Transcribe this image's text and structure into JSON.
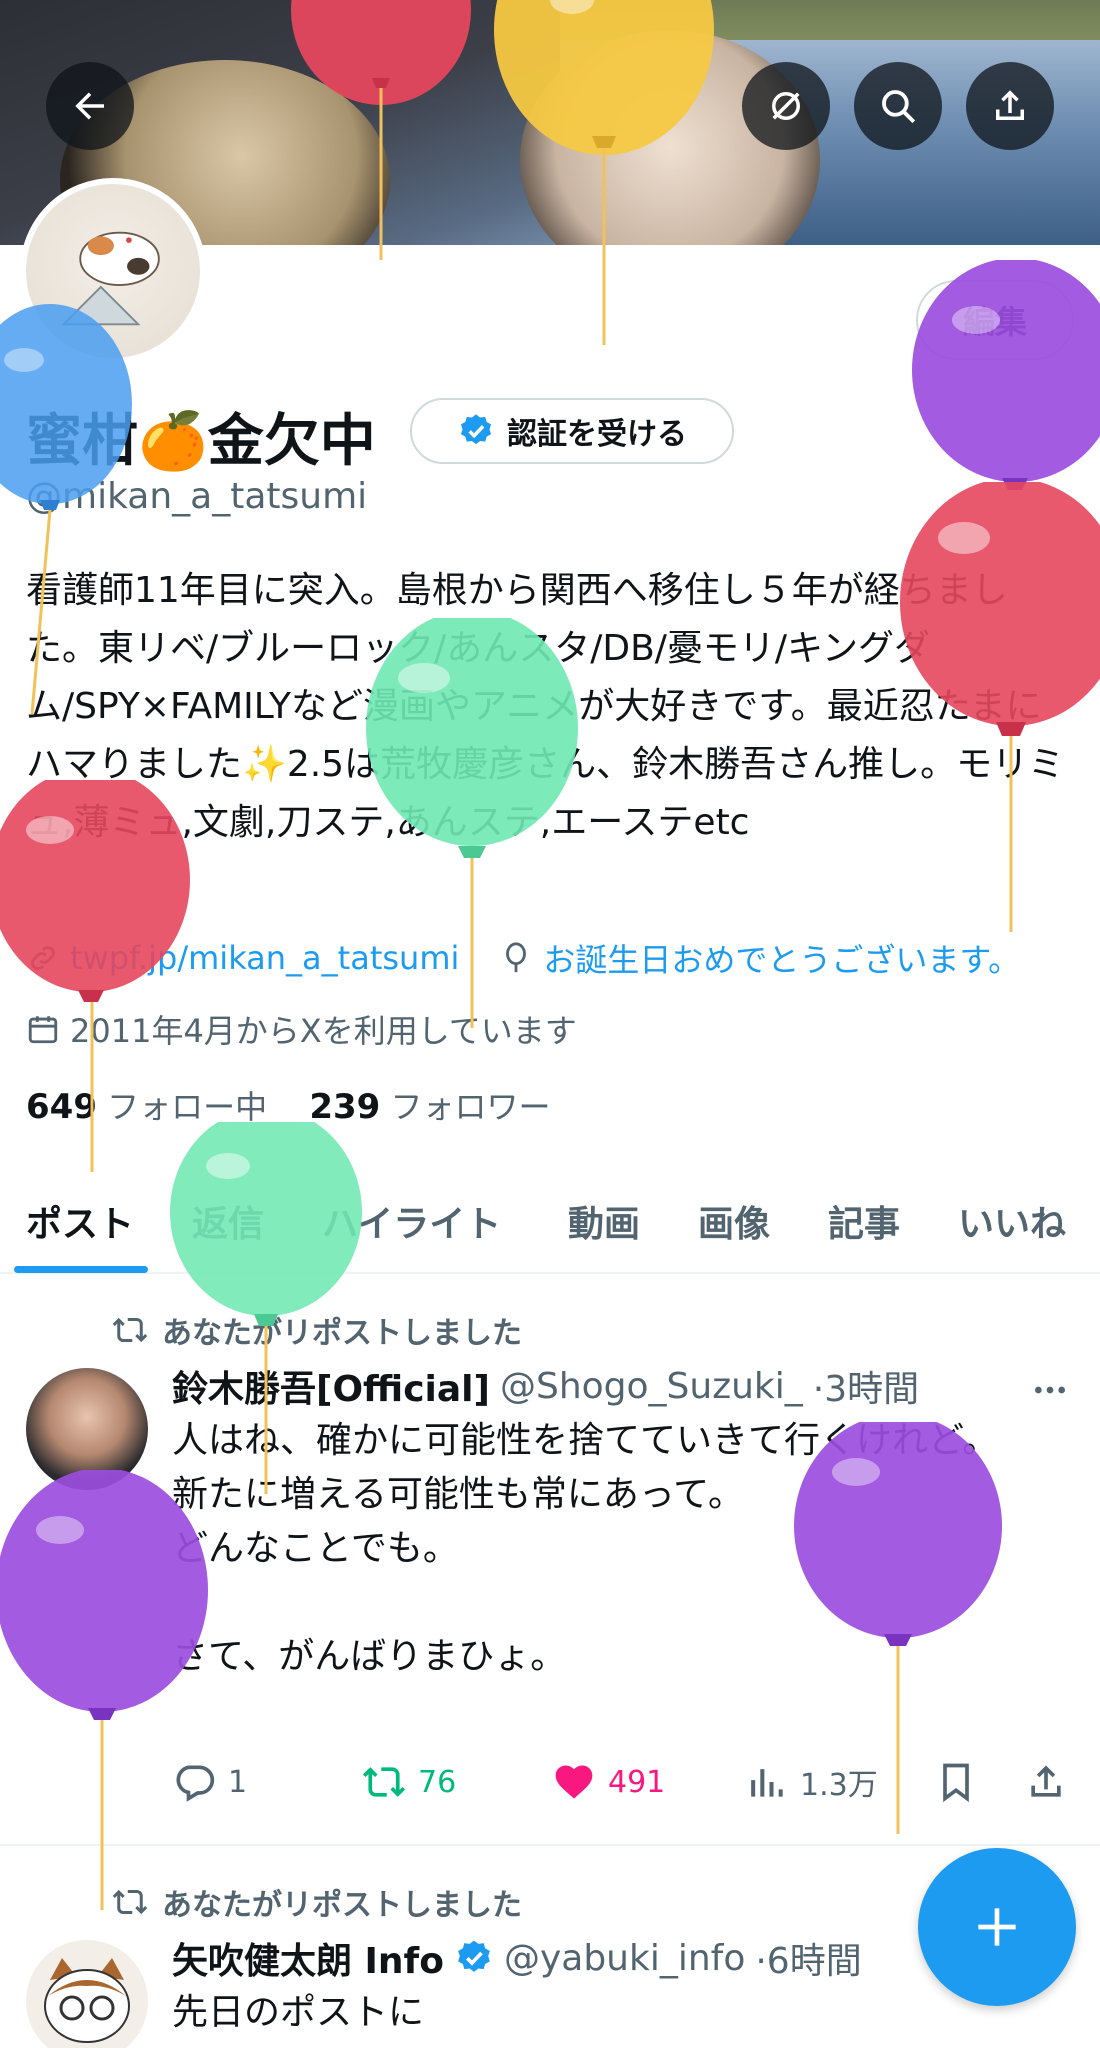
{
  "profile": {
    "name": "蜜柑🍊金欠中",
    "handle": "@mikan_a_tatsumi",
    "edit_label": "編集",
    "verify_label": "認証を受ける",
    "bio": "看護師11年目に突入。島根から関西へ移住し５年が経ちました。東リベ/ブルーロック/あんスタ/DB/憂モリ/キングダム/SPY×FAMILYなど漫画やアニメが大好きです。最近忍たまにハマりました✨2.5は荒牧慶彦さん、鈴木勝吾さん推し。モリミュ,薄ミュ,文劇,刀ステ,あんステ,エーステetc",
    "link": "twpf.jp/mikan_a_tatsumi",
    "birthday": "お誕生日おめでとうございます。",
    "joined": "2011年4月からXを利用しています",
    "following_count": "649",
    "following_label": "フォロー中",
    "followers_count": "239",
    "followers_label": "フォロワー"
  },
  "tabs": [
    "ポスト",
    "返信",
    "ハイライト",
    "動画",
    "画像",
    "記事",
    "いいね"
  ],
  "posts": [
    {
      "repost_label": "あなたがリポストしました",
      "author": "鈴木勝吾[Official]",
      "handle": "@Shogo_Suzuki_",
      "time": "·3時間",
      "text": "人はね、確かに可能性を捨てていきて行くけれど。\n新たに増える可能性も常にあって。\nどんなことでも。\n\nさて、がんばりまひょ。",
      "replies": "1",
      "reposts": "76",
      "likes": "491",
      "views": "1.3万"
    },
    {
      "repost_label": "あなたがリポストしました",
      "author": "矢吹健太朗 Info",
      "handle": "@yabuki_info",
      "time": "·6時間",
      "text": "先日のポストに"
    }
  ],
  "colors": {
    "accent": "#1d9bf0",
    "repost_green": "#00ba7c",
    "like_pink": "#f91880",
    "balloon_red": "#e5475e",
    "balloon_yellow": "#f5c842",
    "balloon_blue": "#4a9ef0",
    "balloon_purple": "#9b4de0",
    "balloon_green": "#6fe8b3"
  },
  "icons": [
    "back-arrow-icon",
    "edit-photo-icon",
    "search-icon",
    "share-icon",
    "link-icon",
    "balloon-icon",
    "calendar-icon",
    "repost-icon",
    "reply-icon",
    "like-icon",
    "views-icon",
    "bookmark-icon",
    "more-icon",
    "verified-badge-icon",
    "compose-plus-icon"
  ]
}
